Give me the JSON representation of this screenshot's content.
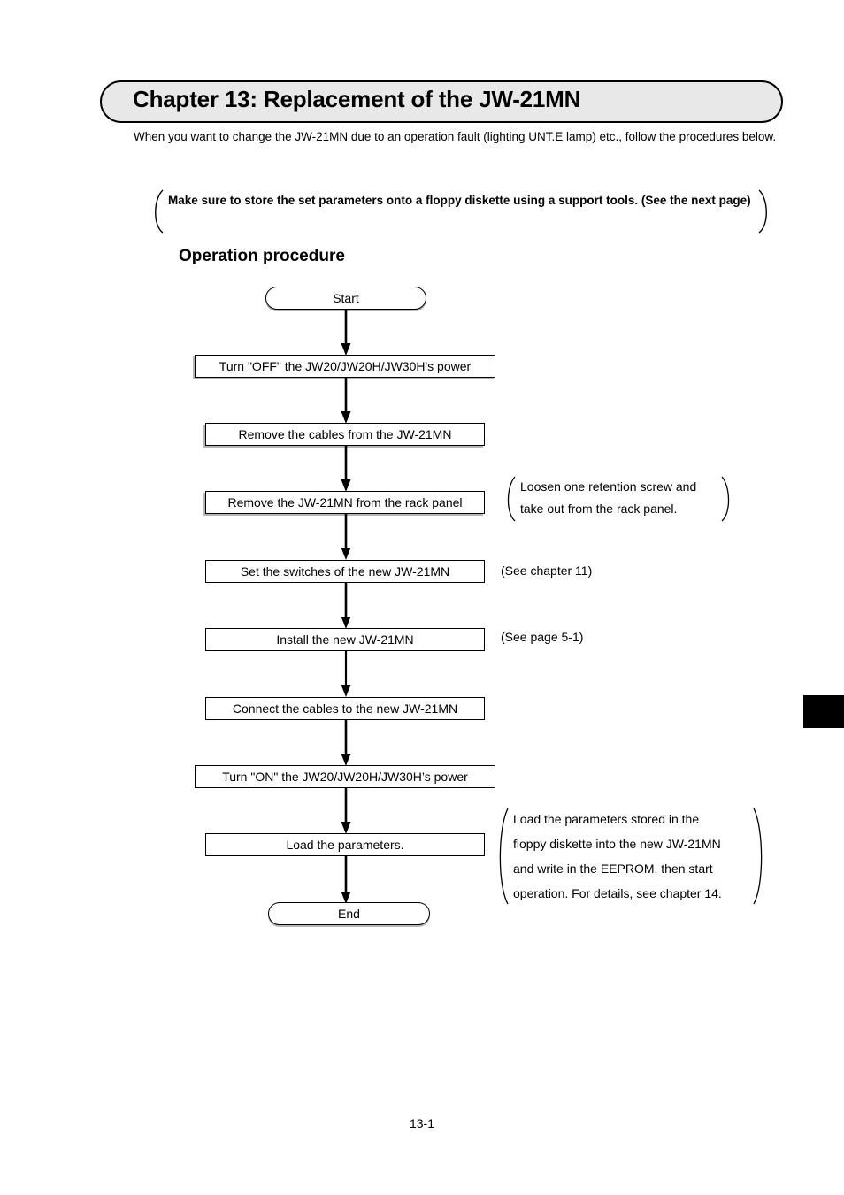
{
  "page": {
    "chapter_title": "Chapter 13: Replacement of the JW-21MN",
    "intro": "When you want to change the JW-21MN due to an operation fault (lighting UNT.E lamp) etc., follow the procedures below.",
    "page_number": "13-1"
  },
  "top_note": {
    "text": "Make sure to store the set parameters onto a floppy diskette using a support tools. (See the next page)"
  },
  "section": {
    "heading": "Operation procedure"
  },
  "flowchart": {
    "nodes": [
      {
        "id": "start",
        "shape": "terminator",
        "label": "Start"
      },
      {
        "id": "power-off",
        "shape": "process",
        "label": "Turn \"OFF\" the JW20/JW20H/JW30H's power"
      },
      {
        "id": "remove-cables",
        "shape": "process",
        "label": "Remove the cables from the JW-21MN"
      },
      {
        "id": "remove-unit",
        "shape": "process",
        "label": "Remove the JW-21MN from the rack panel"
      },
      {
        "id": "set-switches",
        "shape": "process",
        "label": "Set the switches of the new JW-21MN"
      },
      {
        "id": "install-unit",
        "shape": "process",
        "label": "Install the new JW-21MN"
      },
      {
        "id": "connect-cables",
        "shape": "process",
        "label": "Connect the cables to the new JW-21MN"
      },
      {
        "id": "power-on",
        "shape": "process",
        "label": "Turn \"ON\" the JW20/JW20H/JW30H’s power"
      },
      {
        "id": "load-parameters",
        "shape": "process",
        "label": "Load the parameters."
      },
      {
        "id": "end",
        "shape": "terminator",
        "label": "End"
      }
    ],
    "annotations": {
      "remove_unit_note_line1": "Loosen one retention screw and",
      "remove_unit_note_line2": "take out from the rack panel.",
      "set_switches_ref": "(See chapter 11)",
      "install_unit_ref": "(See page 5-1)",
      "load_note_line1": "Load the parameters stored in the",
      "load_note_line2": "floppy diskette into the new JW-21MN",
      "load_note_line3": "and write in the EEPROM, then start",
      "load_note_line4": "operation. For details, see chapter 14."
    }
  },
  "colors": {
    "banner_fill": "#e8e8e8",
    "ink": "#000000",
    "shadow": "#b5b5b5"
  }
}
